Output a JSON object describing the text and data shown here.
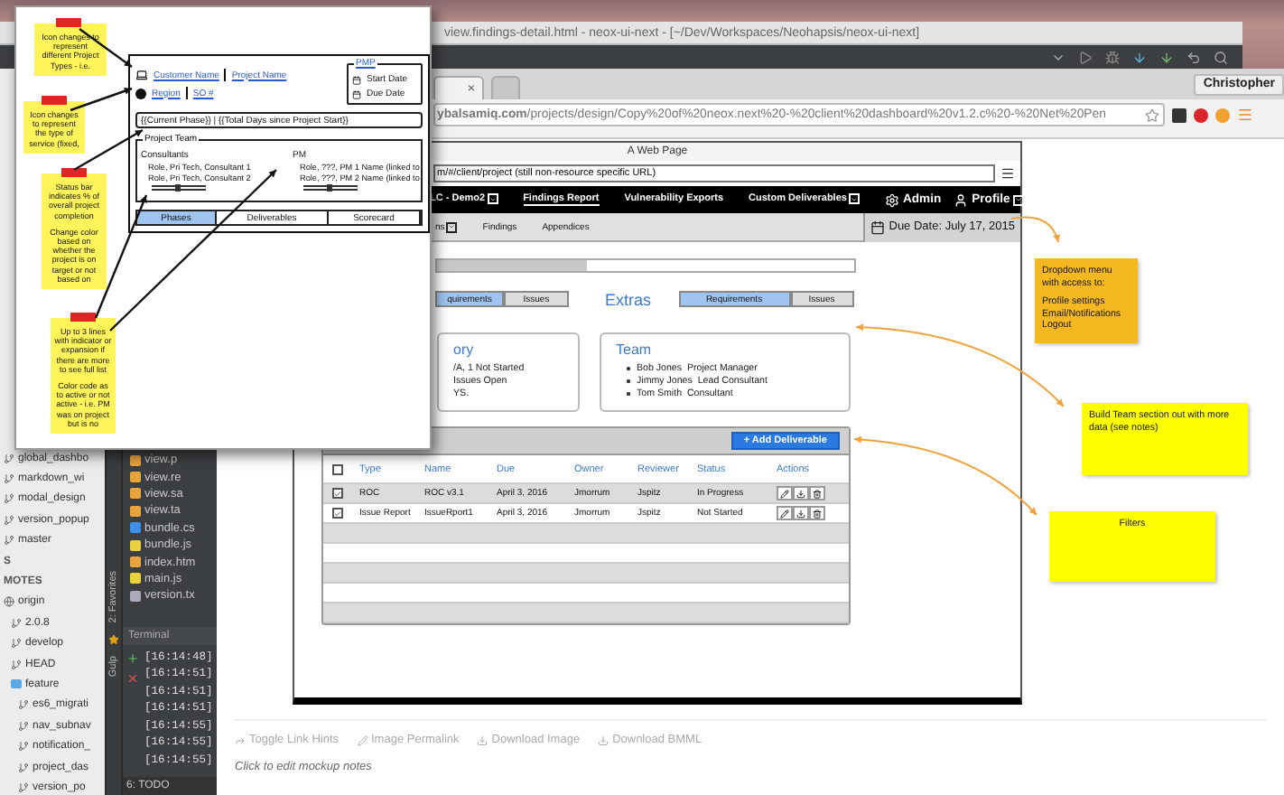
{
  "ide": {
    "title": "view.findings-detail.html - neox-ui-next - [~/Dev/Workspaces/Neohapsis/neox-ui-next]",
    "git_tree": [
      {
        "label": "global_dashbo",
        "kind": "branch"
      },
      {
        "label": "markdown_wi",
        "kind": "branch"
      },
      {
        "label": "modal_design",
        "kind": "branch"
      },
      {
        "label": "version_popup",
        "kind": "branch"
      },
      {
        "label": "master",
        "kind": "branch"
      },
      {
        "label": "S",
        "kind": "header"
      },
      {
        "label": "MOTES",
        "kind": "header"
      },
      {
        "label": "origin",
        "kind": "remote",
        "children": [
          {
            "label": "2.0.8",
            "kind": "branch"
          },
          {
            "label": "develop",
            "kind": "branch"
          },
          {
            "label": "HEAD",
            "kind": "branch"
          },
          {
            "label": "feature",
            "kind": "folder",
            "children": [
              {
                "label": "es6_migrati",
                "kind": "branch"
              },
              {
                "label": "nav_subnav",
                "kind": "branch"
              },
              {
                "label": "notification_",
                "kind": "branch"
              },
              {
                "label": "project_das",
                "kind": "branch"
              },
              {
                "label": "version_po",
                "kind": "branch"
              }
            ]
          }
        ]
      }
    ],
    "files": [
      {
        "name": "view.p",
        "kind": "html"
      },
      {
        "name": "view.re",
        "kind": "html"
      },
      {
        "name": "view.sa",
        "kind": "html"
      },
      {
        "name": "view.ta",
        "kind": "html"
      },
      {
        "name": "bundle.cs",
        "kind": "css"
      },
      {
        "name": "bundle.js",
        "kind": "js"
      },
      {
        "name": "index.htm",
        "kind": "html"
      },
      {
        "name": "main.js",
        "kind": "js"
      },
      {
        "name": "version.tx",
        "kind": "txt"
      }
    ],
    "side_tabs": [
      "2: Favorites",
      "Gulp"
    ],
    "terminal": {
      "title": "Terminal",
      "lines": [
        "[16:14:48]",
        "[16:14:51]",
        "[16:14:51]",
        "[16:14:51]",
        "[16:14:55]",
        "[16:14:55]",
        "[16:14:55]"
      ]
    },
    "bottom_tab": "6: TODO"
  },
  "browser": {
    "tab_close": "×",
    "profile": "Christopher",
    "url_host": "ybalsamiq.com",
    "url_path": "/projects/design/Copy%20of%20neox.next%20-%20client%20dashboard%20v1.2.c%20-%20Net%20Pen",
    "mockup": {
      "page_title": "A Web Page",
      "url": "m/#/client/project (still non-resource specific URL)",
      "nav": [
        {
          "label": "LC - Demo2",
          "dropdown": true,
          "selected": false
        },
        {
          "label": "Findings Report",
          "dropdown": false,
          "selected": true
        },
        {
          "label": "Vulnerability Exports",
          "dropdown": false,
          "selected": false
        },
        {
          "label": "Custom Deliverables",
          "dropdown": true,
          "selected": false
        }
      ],
      "admin": "Admin",
      "profile": "Profile",
      "subnav": [
        {
          "label": "ns",
          "dropdown": true
        },
        {
          "label": "Findings",
          "dropdown": false
        },
        {
          "label": "Appendices",
          "dropdown": false
        }
      ],
      "due_date": "Due Date: July 17, 2015",
      "progress": {
        "level": 0.36
      },
      "left_segments": [
        {
          "label": "quirements",
          "selected": true
        },
        {
          "label": "Issues",
          "selected": false
        }
      ],
      "extras_title": "Extras",
      "right_segments": [
        {
          "label": "Requirements",
          "selected": true
        },
        {
          "label": "Issues",
          "selected": false
        }
      ],
      "summary_card": {
        "title": "ory",
        "lines": [
          "/A, 1 Not Started",
          "Issues Open",
          "YS."
        ]
      },
      "team_card": {
        "title": "Team",
        "members": [
          {
            "name": "Bob Jones",
            "role": "Project Manager"
          },
          {
            "name": "Jimmy Jones",
            "role": "Lead Consultant"
          },
          {
            "name": "Tom Smith",
            "role": "Consultant"
          }
        ]
      },
      "deliverables": {
        "add_button": "+ Add Deliverable",
        "header_checked": false,
        "columns": [
          "Type",
          "Name",
          "Due",
          "Owner",
          "Reviewer",
          "Status",
          "Actions"
        ],
        "rows": [
          {
            "checked": true,
            "cells": [
              "ROC",
              "ROC v3.1",
              "April 3, 2016",
              "Jmorrum",
              "Jspitz",
              "In Progress"
            ]
          },
          {
            "checked": true,
            "cells": [
              "Issue Report",
              "IssueRport1",
              "April 3, 2016",
              "Jmorrum",
              "Jspitz",
              "Not Started"
            ]
          }
        ]
      }
    },
    "stickies": [
      {
        "color": "#f5b820",
        "kind": "left",
        "paragraphs": [
          [
            "Dropdown menu with access to:"
          ],
          [
            "Profile settings",
            "Email/Notifications",
            "Logout"
          ]
        ]
      },
      {
        "color": "#ffff00",
        "kind": "left",
        "paragraphs": [
          [
            "Build Team section out with more data (see notes)"
          ]
        ]
      },
      {
        "color": "#ffff00",
        "kind": "centered",
        "paragraphs": [
          [
            "Filters"
          ]
        ]
      }
    ],
    "footer": {
      "links": [
        {
          "label": "Toggle Link Hints",
          "kind": "share"
        },
        {
          "label": "Image Permalink",
          "kind": "pencil"
        },
        {
          "label": "Download Image",
          "kind": "download"
        },
        {
          "label": "Download BMML",
          "kind": "download"
        }
      ],
      "notes": "Click to edit mockup notes"
    }
  },
  "popup": {
    "stickies": [
      {
        "paragraphs": [
          "Icon changes to represent different Project Types - i.e."
        ]
      },
      {
        "paragraphs": [
          "Icon changes to represent the type of service (fixed,"
        ]
      },
      {
        "paragraphs": [
          "Status bar indicates % of overall project completion",
          "Change color based on whether the project is on target or not based on"
        ]
      },
      {
        "paragraphs": [
          "Up to 3 lines with indicator or expansion if there are more to see full list",
          "Color code as to active or not active - i.e. PM was on project but is no"
        ]
      }
    ],
    "mockup": {
      "customer": "Customer Name",
      "project": "Project Name",
      "region": "Region",
      "so": "SO #",
      "pmp": {
        "legend": "PMP",
        "start": "Start Date",
        "due": "Due Date"
      },
      "phase_bar": "{{Current Phase}} | {{Total Days since Project Start}}",
      "team": {
        "legend": "Project Team",
        "consultants_label": "Consultants",
        "pm_label": "PM",
        "consultants": [
          "Role, Pri Tech, Consultant 1",
          "Role, Pri Tech, Consultant 2"
        ],
        "pms": [
          "Role, ???, PM 1 Name (linked to",
          "Role, ???, PM 2 Name (linked to"
        ]
      },
      "tabs": [
        {
          "label": "Phases",
          "selected": true
        },
        {
          "label": "Deliverables",
          "selected": false
        },
        {
          "label": "Scorecard",
          "selected": false
        }
      ]
    }
  }
}
